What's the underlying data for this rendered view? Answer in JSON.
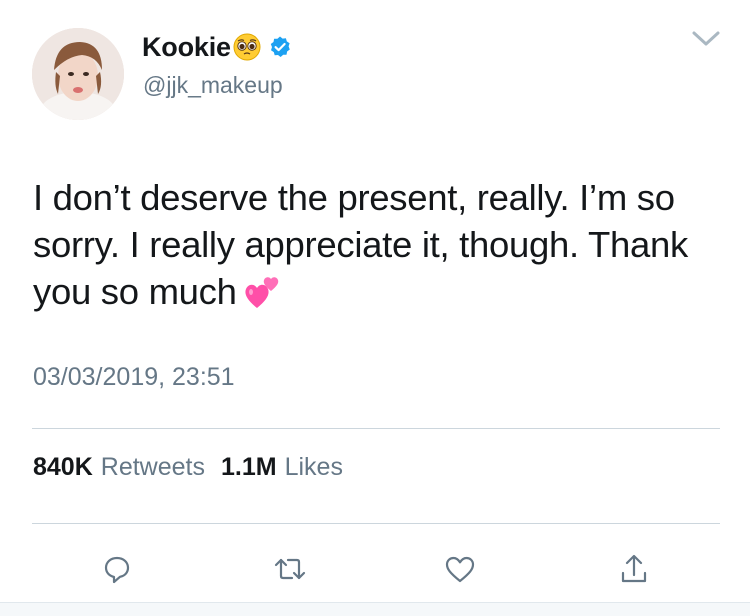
{
  "author": {
    "display_name": "Kookie",
    "name_emoji": "pleading-face-icon",
    "verified": true,
    "handle": "@jjk_makeup"
  },
  "tweet": {
    "text": "I don’t deserve the present, really. I’m so sorry. I really appreciate it, though. Thank you so much",
    "trailing_emoji": "two-hearts-icon",
    "timestamp": "03/03/2019, 23:51"
  },
  "stats": {
    "retweets_count": "840K",
    "retweets_label": "Retweets",
    "likes_count": "1.1M",
    "likes_label": "Likes"
  },
  "actions": [
    "reply-icon",
    "retweet-icon",
    "like-icon",
    "share-icon"
  ],
  "colors": {
    "text": "#14171a",
    "secondary": "#657786",
    "verified": "#1da1f2",
    "divider": "#ccd6dd",
    "heart": "#ff4fa8"
  }
}
